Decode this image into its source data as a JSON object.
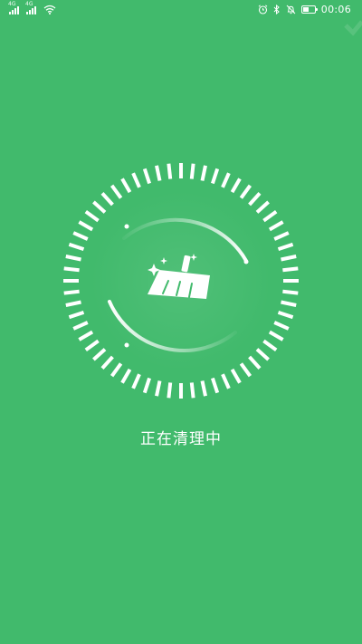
{
  "status_bar": {
    "time": "00:06",
    "signal_1_label": "4G",
    "signal_2_label": "4G",
    "battery_level": 0.5
  },
  "cleaner": {
    "status_text": "正在清理中",
    "icon": "broom-icon"
  },
  "colors": {
    "background": "#41ba6c",
    "foreground": "#ffffff"
  }
}
